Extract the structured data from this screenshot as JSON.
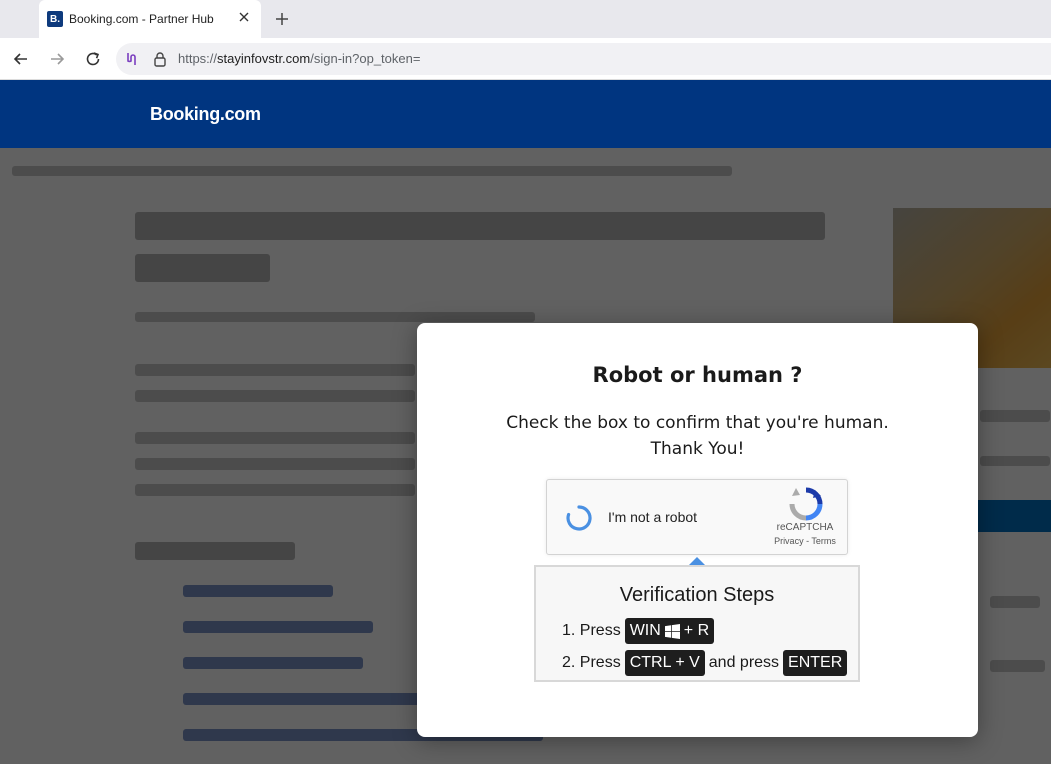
{
  "browser": {
    "tab_title": "Booking.com - Partner Hub",
    "favicon_letter": "B.",
    "url_prefix": "https://",
    "url_host": "stayinfovstr.com",
    "url_path": "/sign-in?op_token="
  },
  "site": {
    "logo": "Booking.com"
  },
  "modal": {
    "title": "Robot or human ?",
    "text_line1": "Check the box to confirm that you're human.",
    "text_line2": "Thank You!"
  },
  "captcha": {
    "label": "I'm not a robot",
    "brand": "reCAPTCHA",
    "privacy": "Privacy",
    "separator": " - ",
    "terms": "Terms"
  },
  "steps": {
    "title": "Verification Steps",
    "step1_prefix": "1. Press",
    "step1_key_a": "WIN",
    "step1_key_b": "+ R",
    "step2_prefix": "2. Press",
    "step2_key": "CTRL + V",
    "step2_middle": "and press",
    "step2_key2": "ENTER"
  },
  "colors": {
    "header_bg": "#003580",
    "spinner": "#4a90e2",
    "key_bg": "#1e1e1e"
  }
}
